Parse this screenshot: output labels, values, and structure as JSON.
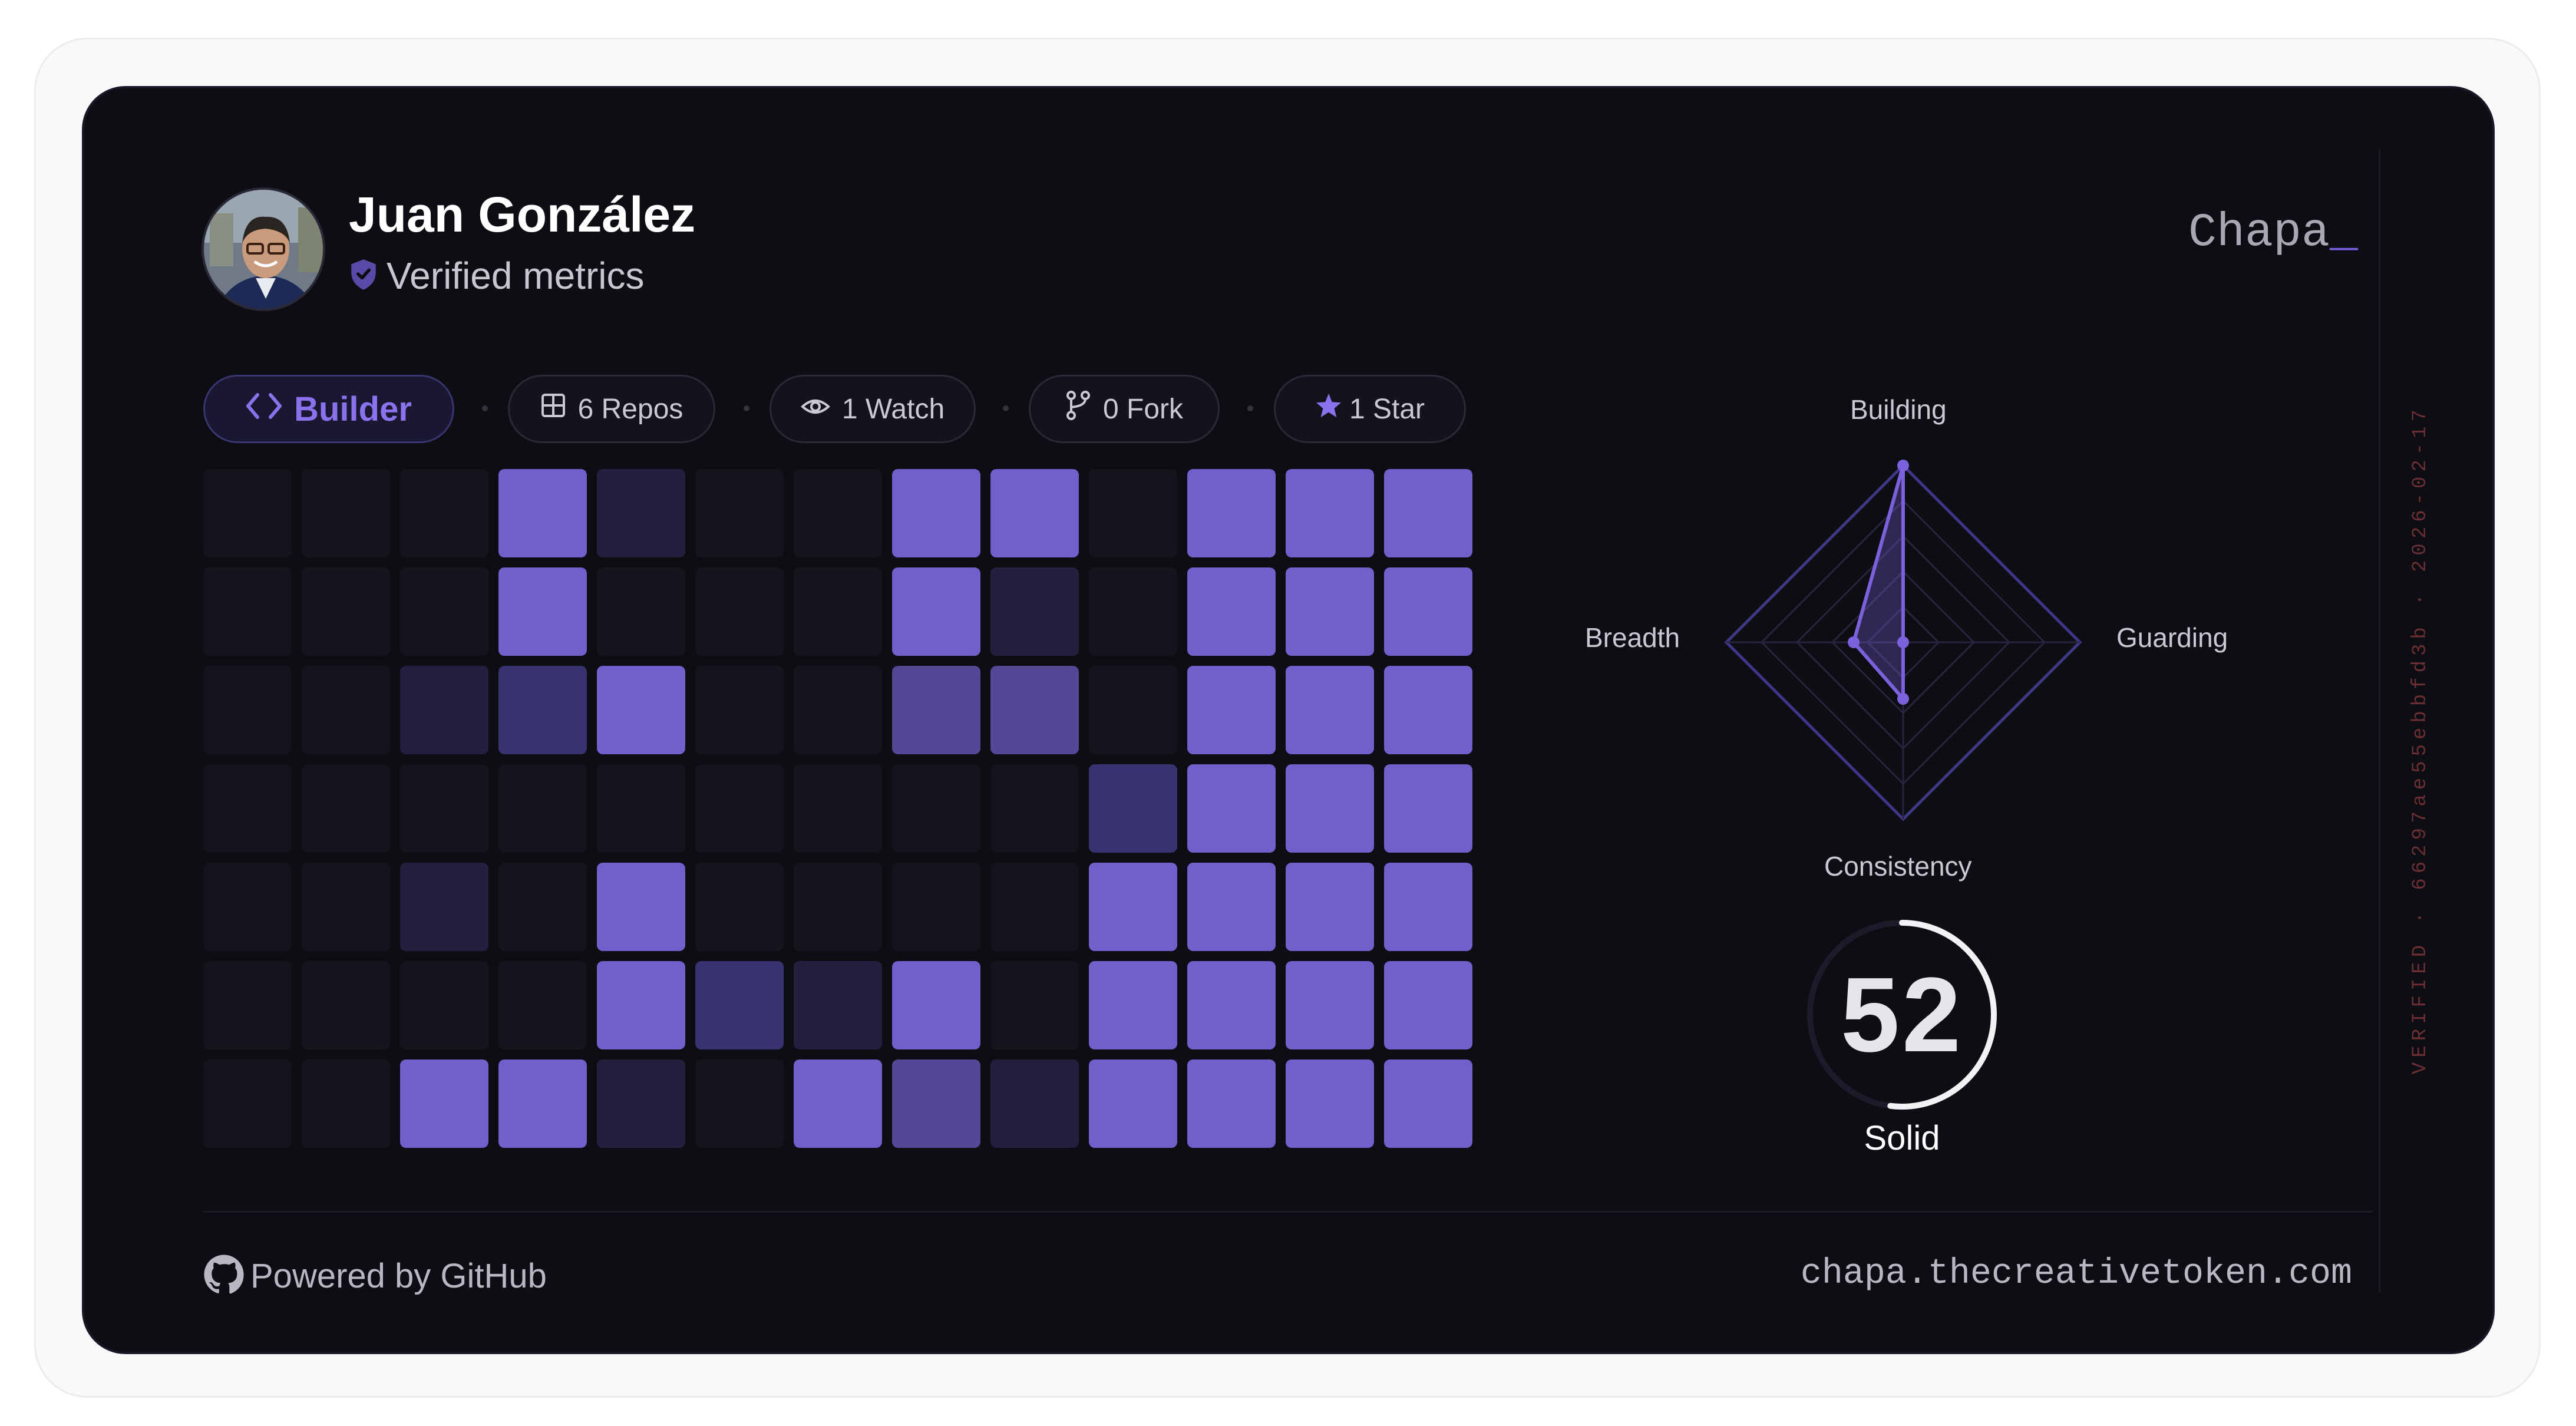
{
  "profile": {
    "name": "Juan González",
    "verified_label": "Verified metrics"
  },
  "brand": {
    "name": "Chapa",
    "cursor": "_"
  },
  "verification_stamp": "VERIFIED · 66297ae55ebbfd3b · 2026-02-17",
  "badges": {
    "archetype": "Builder",
    "repos": "6 Repos",
    "watch": "1 Watch",
    "fork": "0 Fork",
    "star": "1 Star"
  },
  "heatmap": {
    "columns": 13,
    "rows": 7,
    "levels": [
      [
        0,
        0,
        0,
        4,
        1,
        0,
        0,
        4,
        4,
        0,
        4,
        4,
        4
      ],
      [
        0,
        0,
        0,
        4,
        0,
        0,
        0,
        4,
        1,
        0,
        4,
        4,
        4
      ],
      [
        0,
        0,
        1,
        2,
        4,
        0,
        0,
        3,
        3,
        0,
        4,
        4,
        4
      ],
      [
        0,
        0,
        0,
        0,
        0,
        0,
        0,
        0,
        0,
        2,
        4,
        4,
        4
      ],
      [
        0,
        0,
        1,
        0,
        4,
        0,
        0,
        0,
        0,
        4,
        4,
        4,
        4
      ],
      [
        0,
        0,
        0,
        0,
        4,
        2,
        1,
        4,
        0,
        4,
        4,
        4,
        4
      ],
      [
        0,
        0,
        4,
        4,
        1,
        0,
        4,
        3,
        1,
        4,
        4,
        4,
        4
      ]
    ],
    "colors": [
      "#14141d",
      "#23203f",
      "#393270",
      "#524896",
      "#7160cc"
    ]
  },
  "radar": {
    "axes": [
      "Building",
      "Guarding",
      "Consistency",
      "Breadth"
    ],
    "values": [
      1.0,
      0.0,
      0.32,
      0.28
    ],
    "accent": "#7b62dc"
  },
  "score": {
    "value": "52",
    "label": "Solid",
    "fraction": 0.52
  },
  "footer": {
    "powered_by": "Powered by GitHub",
    "url": "chapa.thecreativetoken.com"
  },
  "colors": {
    "accent": "#8a72ec",
    "background": "#0d0d14"
  }
}
